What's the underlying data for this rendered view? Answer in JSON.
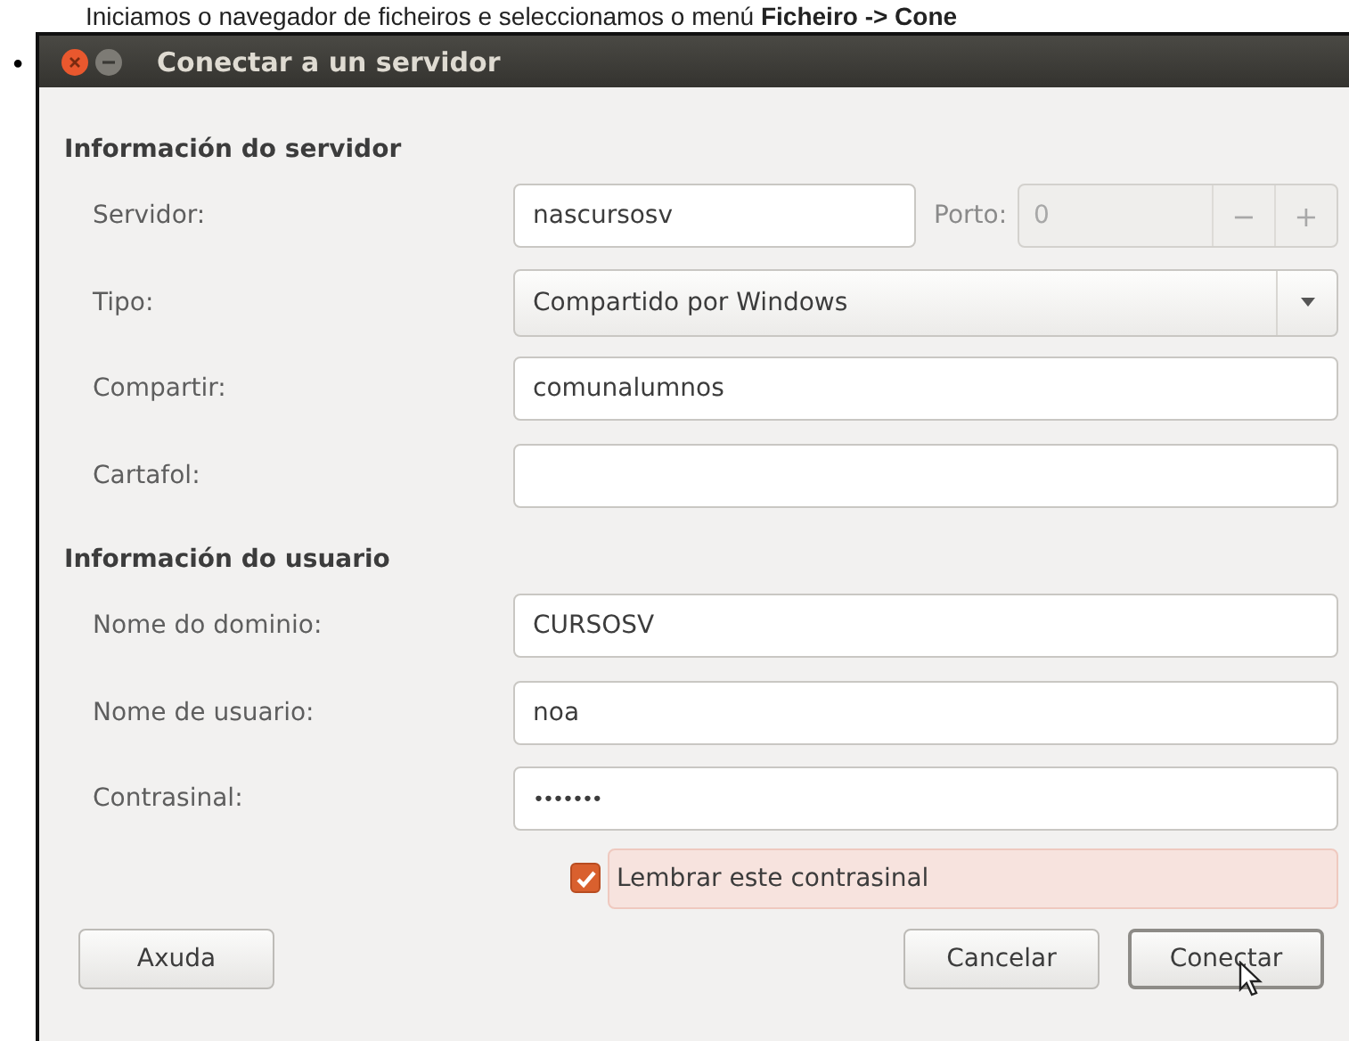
{
  "intro": {
    "bullet": "•",
    "text": "Iniciamos o navegador de ficheiros e seleccionamos o menú **Ficheiro -> Cone**"
  },
  "window": {
    "title": "Conectar a un servidor"
  },
  "sections": [
    {
      "heading": "Información do servidor",
      "fields": [
        {
          "kind": "text",
          "label": "Servidor:",
          "value": "nascursosv",
          "port": {
            "label": "Porto:",
            "value": "0",
            "disabled": true,
            "minus": "−",
            "plus": "+"
          }
        },
        {
          "kind": "combo",
          "label": "Tipo:",
          "value": "Compartido por Windows"
        },
        {
          "kind": "text",
          "label": "Compartir:",
          "value": "comunalumnos"
        },
        {
          "kind": "text",
          "label": "Cartafol:"
        }
      ]
    },
    {
      "heading": "Información do usuario",
      "fields": [
        {
          "kind": "text",
          "label": "Nome do dominio:",
          "value": "CURSOSV"
        },
        {
          "kind": "text",
          "label": "Nome de usuario:",
          "value": "noa"
        },
        {
          "kind": "password",
          "label": "Contrasinal:",
          "value": "•••••••"
        }
      ]
    }
  ],
  "remember": {
    "label": "Lembrar este contrasinal",
    "checked": true
  },
  "buttons": {
    "help": "Axuda",
    "cancel": "Cancelar",
    "connect": "Conectar"
  }
}
